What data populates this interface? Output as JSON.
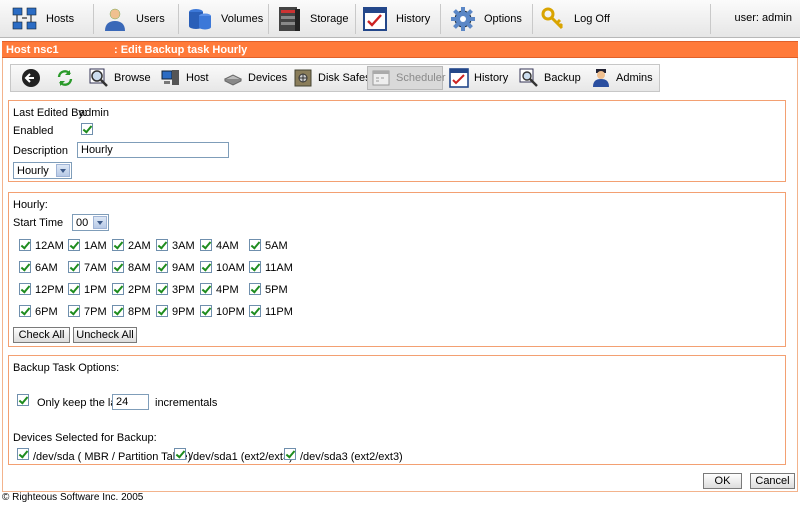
{
  "topnav": {
    "items": [
      {
        "label": "Hosts",
        "icon": "hosts-icon"
      },
      {
        "label": "Users",
        "icon": "users-icon"
      },
      {
        "label": "Volumes",
        "icon": "volumes-icon"
      },
      {
        "label": "Storage",
        "icon": "storage-icon"
      },
      {
        "label": "History",
        "icon": "history-icon"
      },
      {
        "label": "Options",
        "icon": "gear-icon"
      },
      {
        "label": "Log Off",
        "icon": "key-icon"
      }
    ],
    "user": "user: admin"
  },
  "header": {
    "host": "Host nsc1",
    "title": ": Edit Backup task Hourly"
  },
  "subnav": {
    "items": [
      {
        "label": "Browse"
      },
      {
        "label": "Host"
      },
      {
        "label": "Devices"
      },
      {
        "label": "Disk Safes"
      },
      {
        "label": "Scheduler"
      },
      {
        "label": "History"
      },
      {
        "label": "Backup"
      },
      {
        "label": "Admins"
      }
    ]
  },
  "general": {
    "last_edited_label": "Last Edited By:",
    "last_edited_value": "admin",
    "enabled_label": "Enabled",
    "description_label": "Description",
    "description_value": "Hourly",
    "frequency_value": "Hourly"
  },
  "hourly": {
    "section_label": "Hourly:",
    "start_time_label": "Start Time",
    "start_time_value": "00",
    "hours": [
      [
        "12AM",
        "1AM",
        "2AM",
        "3AM",
        "4AM",
        "5AM"
      ],
      [
        "6AM",
        "7AM",
        "8AM",
        "9AM",
        "10AM",
        "11AM"
      ],
      [
        "12PM",
        "1PM",
        "2PM",
        "3PM",
        "4PM",
        "5PM"
      ],
      [
        "6PM",
        "7PM",
        "8PM",
        "9PM",
        "10PM",
        "11PM"
      ]
    ],
    "check_all": "Check All",
    "uncheck_all": "Uncheck All"
  },
  "options": {
    "section_label": "Backup Task Options:",
    "keep_label": "Only keep the last",
    "keep_value": "24",
    "keep_suffix": "incrementals",
    "devices_label": "Devices Selected for Backup:",
    "devices": [
      "/dev/sda ( MBR / Partition Table)",
      "/dev/sda1 (ext2/ext3)",
      "/dev/sda3 (ext2/ext3)"
    ]
  },
  "actions": {
    "ok": "OK",
    "cancel": "Cancel"
  },
  "footer": "© Righteous Software Inc. 2005"
}
